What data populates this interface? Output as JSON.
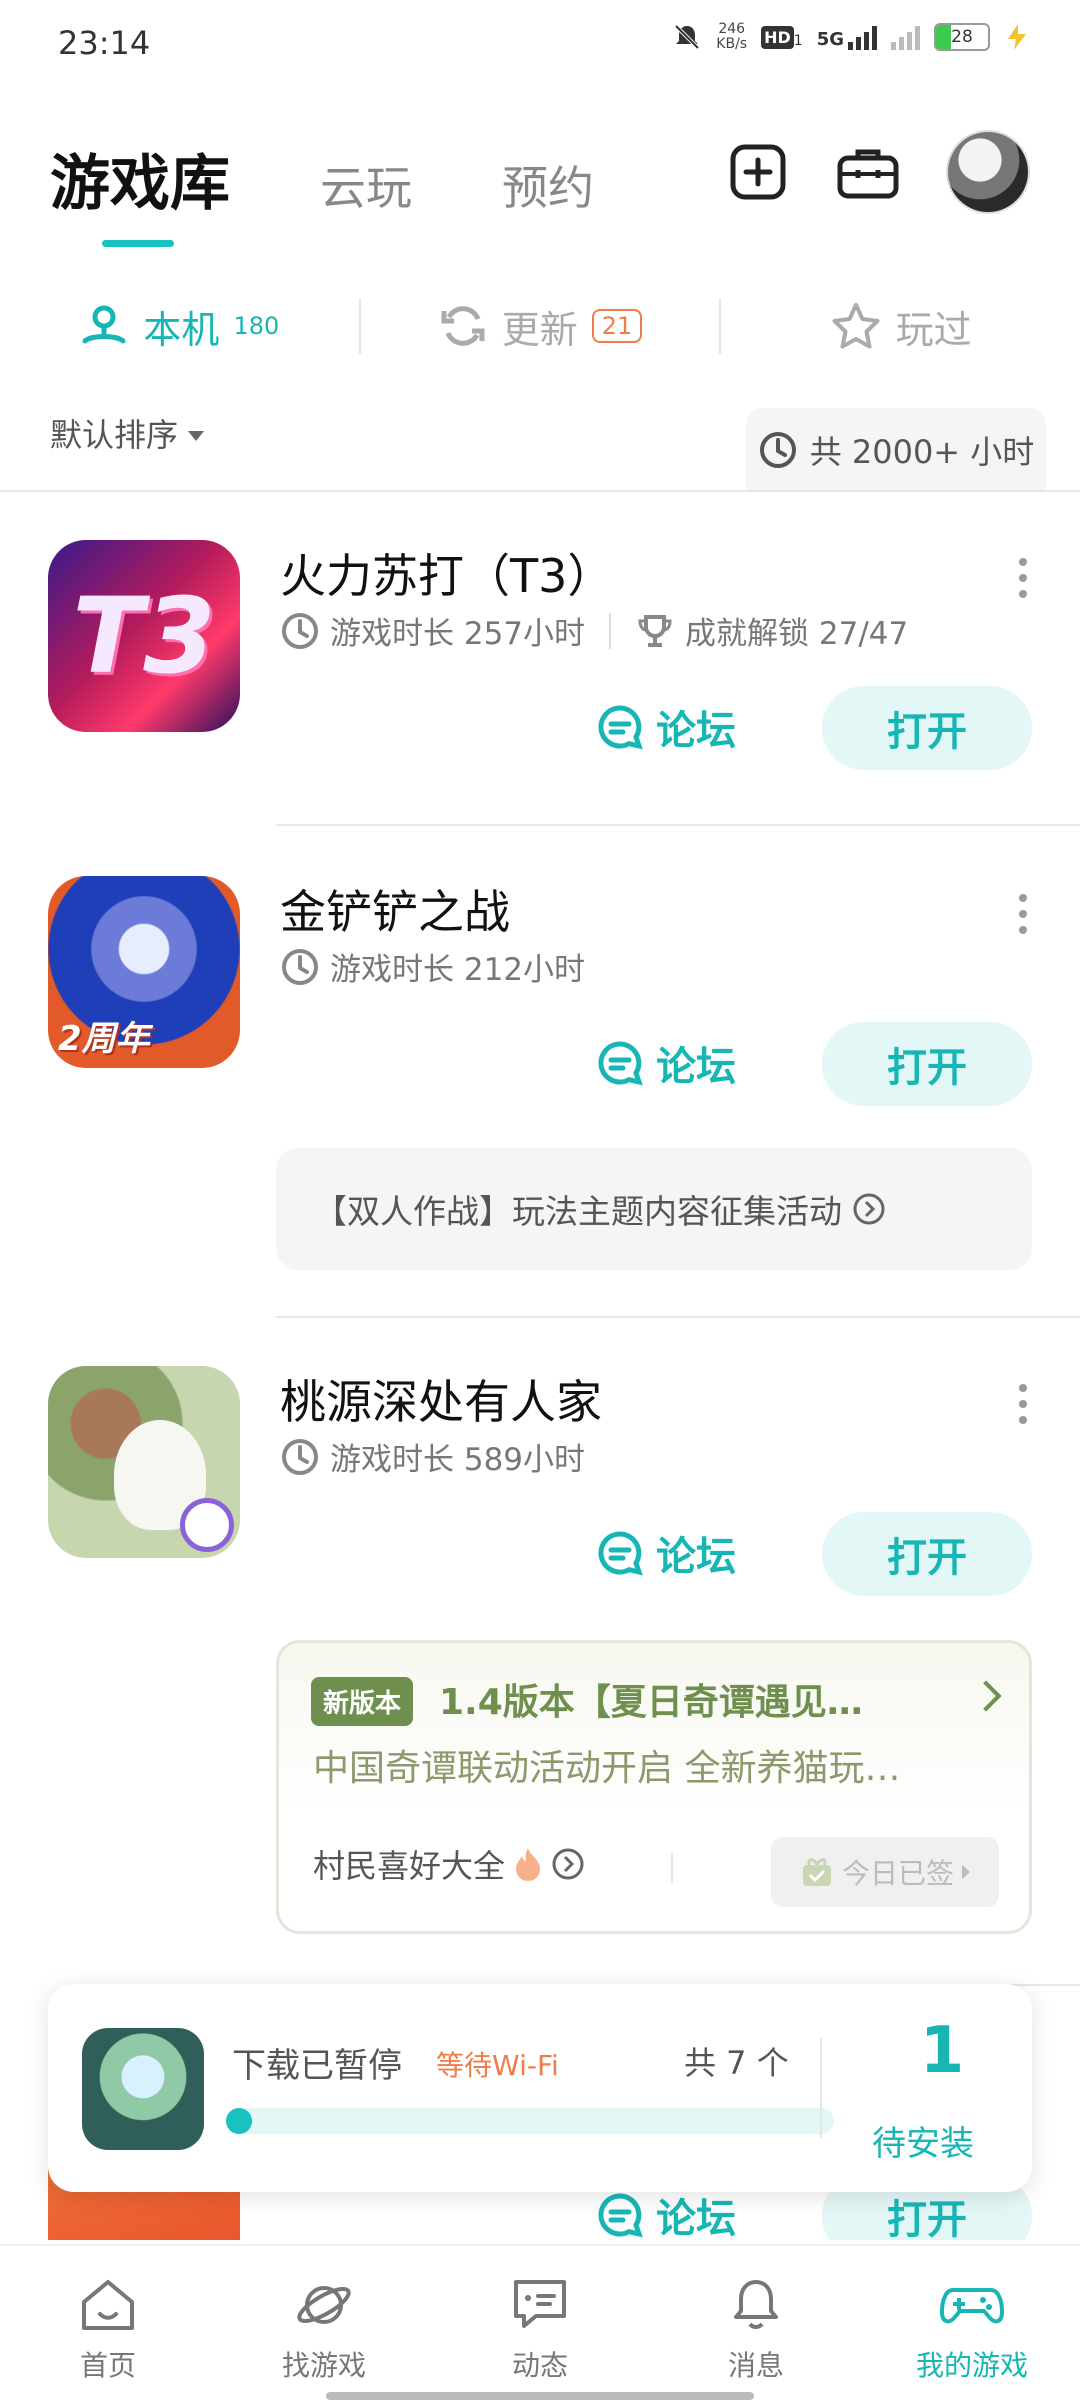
{
  "status_bar": {
    "time": "23:14",
    "net_speed_top": "246",
    "net_speed_bottom": "KB/s",
    "hd": "HD",
    "sim": "1",
    "network": "5G",
    "battery": "28"
  },
  "top_tabs": [
    {
      "label": "游戏库"
    },
    {
      "label": "云玩"
    },
    {
      "label": "预约"
    }
  ],
  "segments": {
    "local": {
      "label": "本机",
      "count": "180"
    },
    "update": {
      "label": "更新",
      "badge": "21"
    },
    "played": {
      "label": "玩过"
    }
  },
  "sort": {
    "label": "默认排序"
  },
  "total_time": "共 2000+ 小时",
  "games": [
    {
      "name": "火力苏打（T3）",
      "playtime": "游戏时长 257小时",
      "achievement": "成就解锁 27/47",
      "forum": "论坛",
      "open": "打开",
      "icon_text": "T3"
    },
    {
      "name": "金铲铲之战",
      "playtime": "游戏时长 212小时",
      "forum": "论坛",
      "open": "打开",
      "badge": "2周年",
      "activity": "【双人作战】玩法主题内容征集活动"
    },
    {
      "name": "桃源深处有人家",
      "playtime": "游戏时长 589小时",
      "forum": "论坛",
      "open": "打开",
      "promo": {
        "tag": "新版本",
        "title": "1.4版本【夏日奇谭遇见…",
        "subtitle": "中国奇谭联动活动开启 全新养猫玩…",
        "foot": "村民喜好大全",
        "signed": "今日已签"
      }
    },
    {
      "forum": "论坛",
      "open": "打开"
    }
  ],
  "download": {
    "title": "下载已暂停",
    "status": "等待Wi-Fi",
    "count": "共 7 个",
    "progress": 0.0,
    "pending_num": "1",
    "pending_label": "待安装"
  },
  "bottom_nav": [
    {
      "label": "首页"
    },
    {
      "label": "找游戏"
    },
    {
      "label": "动态"
    },
    {
      "label": "消息"
    },
    {
      "label": "我的游戏"
    }
  ],
  "colors": {
    "accent": "#17b6b4",
    "warning": "#ef7d4a",
    "promo_green": "#6f8f4e"
  }
}
